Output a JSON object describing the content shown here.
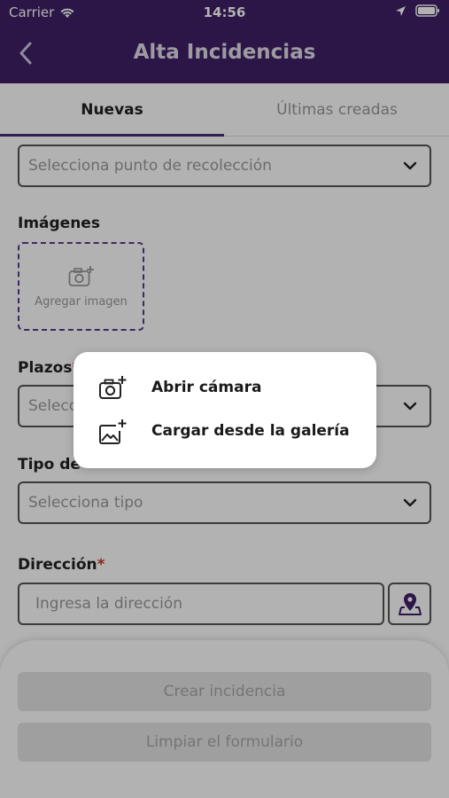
{
  "status_bar": {
    "carrier": "Carrier",
    "time": "14:56"
  },
  "header": {
    "title": "Alta Incidencias"
  },
  "tabs": [
    {
      "label": "Nuevas"
    },
    {
      "label": "Últimas creadas"
    }
  ],
  "form": {
    "collection_point_placeholder": "Selecciona punto de recolección",
    "images_label": "Imágenes",
    "add_image_label": "Agregar imagen",
    "plazos_label": "Plazos",
    "plazos_placeholder": "Selecc",
    "tipo_label": "Tipo de",
    "tipo_placeholder": "Selecciona tipo",
    "direccion_label": "Dirección",
    "required_mark": "*",
    "direccion_placeholder": "Ingresa la dirección"
  },
  "actions": {
    "create_label": "Crear incidencia",
    "clear_label": "Limpiar el formulario"
  },
  "image_menu": {
    "items": [
      {
        "label": "Abrir cámara"
      },
      {
        "label": "Cargar desde la galería"
      }
    ]
  },
  "colors": {
    "brand": "#3f1f66",
    "accent": "#4a2b78",
    "required": "#c0392b"
  }
}
